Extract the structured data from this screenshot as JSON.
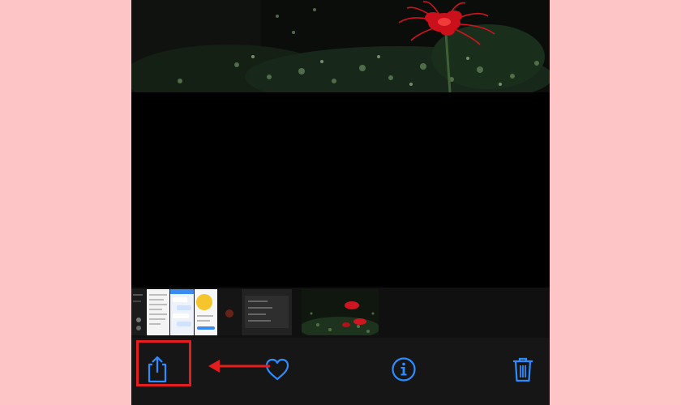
{
  "colors": {
    "page_background": "#FDC5C5",
    "ios_blue": "#2D8CFF",
    "toolbar_background": "#161616",
    "highlight_red": "#E41E1E"
  },
  "toolbar": {
    "buttons": [
      {
        "name": "share",
        "icon": "share-icon"
      },
      {
        "name": "favorite",
        "icon": "heart-icon"
      },
      {
        "name": "info",
        "icon": "info-icon"
      },
      {
        "name": "delete",
        "icon": "trash-icon"
      }
    ]
  },
  "annotation": {
    "highlight": "share-button",
    "arrow_points_to": "share-button"
  }
}
